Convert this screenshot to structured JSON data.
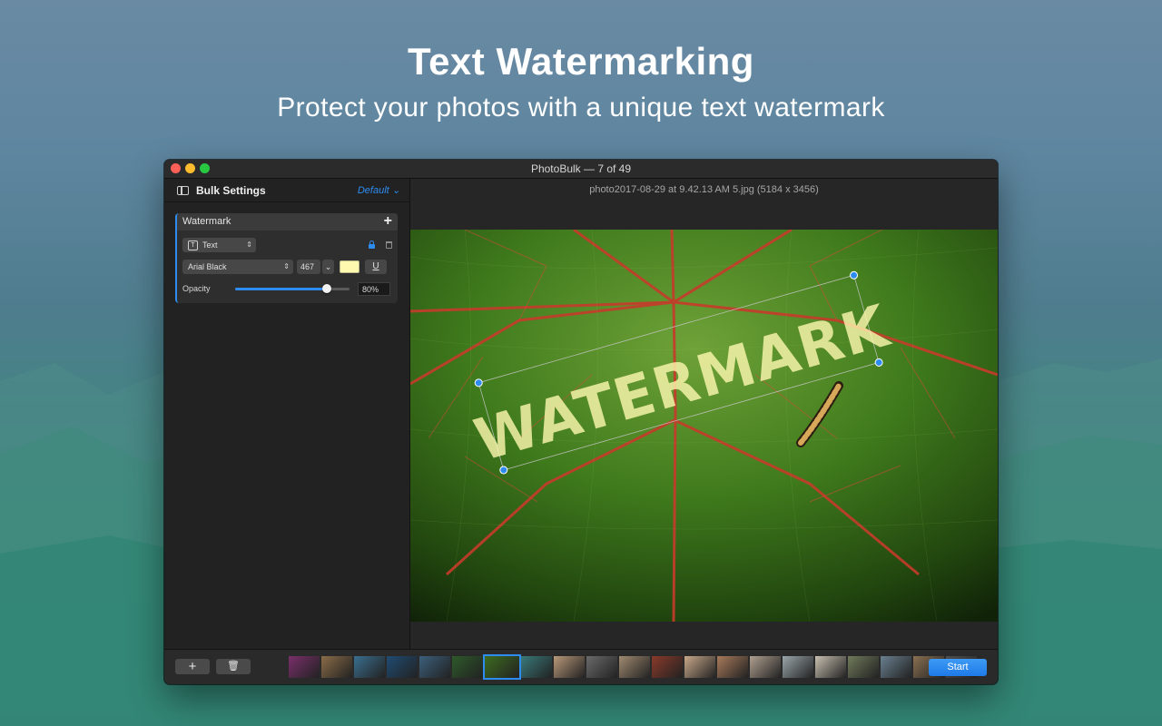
{
  "hero": {
    "title": "Text Watermarking",
    "subtitle": "Protect your photos with a unique text watermark"
  },
  "window": {
    "title": "PhotoBulk — 7 of 49"
  },
  "sidebar": {
    "header_title": "Bulk Settings",
    "preset_label": "Default",
    "panel": {
      "title": "Watermark",
      "add_symbol": "+",
      "type_value": "Text",
      "type_badge": "T",
      "font_value": "Arial Black",
      "font_size": "467",
      "color_hex": "#fff9b0",
      "underline_label": "U",
      "opacity_label": "Opacity",
      "opacity_value": "80%",
      "opacity_fraction": 0.8
    }
  },
  "preview": {
    "filename": "photo2017-08-29 at 9.42.13 AM 5.jpg (5184 x 3456)",
    "watermark_text": "WATERMARK"
  },
  "bottom": {
    "add_symbol": "+",
    "start_label": "Start",
    "thumbnail_colors": [
      "#7a2f6a",
      "#8b6c48",
      "#3a6f8f",
      "#1f4b72",
      "#3c5f7c",
      "#2e5a2a",
      "#3d6b1f",
      "#3a7a7a",
      "#b89878",
      "#6a6a6a",
      "#a08a70",
      "#8a3a2a",
      "#c8a88a",
      "#a87a5a",
      "#b0a090",
      "#9aa6aa",
      "#c8c0b0",
      "#707a5a",
      "#6a8090",
      "#8a7050",
      "#505050"
    ],
    "selected_index": 6
  },
  "colors": {
    "accent": "#2e8cf0"
  }
}
